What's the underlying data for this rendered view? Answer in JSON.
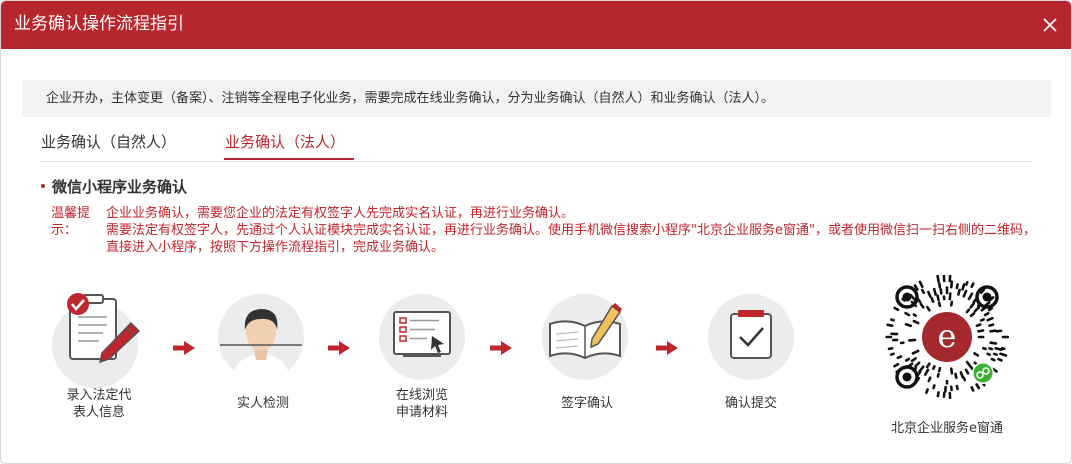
{
  "dialog": {
    "title": "业务确认操作流程指引",
    "accent_color": "#b8262d"
  },
  "notice": "企业开办，主体变更（备案）、注销等全程电子化业务，需要完成在线业务确认，分为业务确认（自然人）和业务确认（法人）。",
  "tabs": [
    {
      "label": "业务确认（自然人）",
      "active": false
    },
    {
      "label": "业务确认（法人）",
      "active": true
    }
  ],
  "section_title": "微信小程序业务确认",
  "tip": {
    "label": "温馨提示：",
    "line1": "企业业务确认，需要您企业的法定有权签字人先完成实名认证，再进行业务确认。",
    "line2": "需要法定有权签字人，先通过个人认证模块完成实名认证，再进行业务确认。使用手机微信搜索小程序\"北京企业服务e窗通\"，或者使用微信扫一扫右侧的二维码，直接进入小程序，按照下方操作流程指引，完成业务确认。"
  },
  "steps": [
    {
      "label_line1": "录入法定代",
      "label_line2": "表人信息",
      "icon": "clipboard-check-icon"
    },
    {
      "label_line1": "实人检测",
      "label_line2": "",
      "icon": "person-portrait-icon"
    },
    {
      "label_line1": "在线浏览",
      "label_line2": "申请材料",
      "icon": "document-browse-icon"
    },
    {
      "label_line1": "签字确认",
      "label_line2": "",
      "icon": "book-pen-icon"
    },
    {
      "label_line1": "确认提交",
      "label_line2": "",
      "icon": "submit-check-icon"
    }
  ],
  "qr": {
    "caption": "北京企业服务e窗通",
    "logo_letter": "e"
  }
}
